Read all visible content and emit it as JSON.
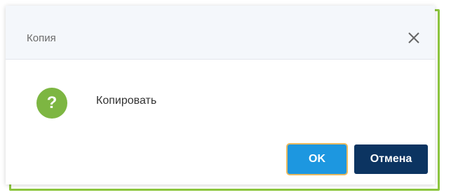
{
  "dialog": {
    "title": "Копия",
    "message": "Копировать",
    "icon": "question-icon",
    "close_icon": "close-icon",
    "ok_label": "OK",
    "cancel_label": "Отмена"
  },
  "colors": {
    "frame_border": "#8dc63f",
    "title_bar": "#f4f7fb",
    "icon_green": "#7db642",
    "ok_button": "#1d97e0",
    "ok_focus_ring": "#e8b960",
    "cancel_button": "#0c3461"
  }
}
